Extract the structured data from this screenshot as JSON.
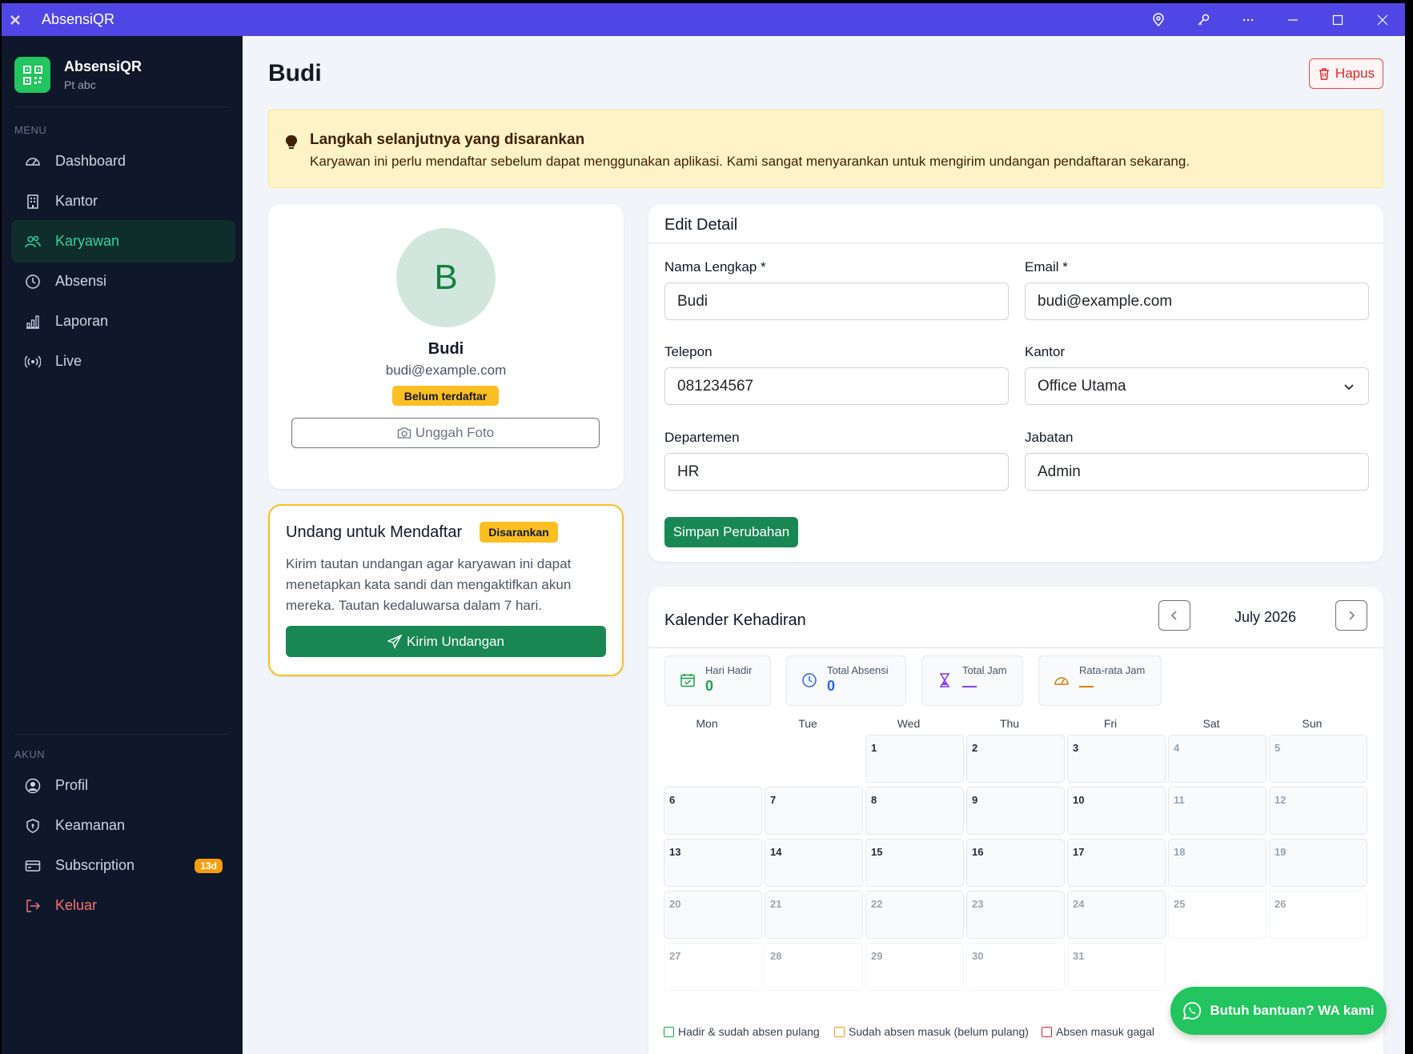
{
  "window": {
    "title": "AbsensiQR"
  },
  "brand": {
    "name": "AbsensiQR",
    "company": "Pt abc"
  },
  "sidebar": {
    "menu_label": "MENU",
    "items": [
      {
        "label": "Dashboard",
        "icon": "gauge-icon"
      },
      {
        "label": "Kantor",
        "icon": "building-icon"
      },
      {
        "label": "Karyawan",
        "icon": "users-icon",
        "active": true
      },
      {
        "label": "Absensi",
        "icon": "clock-icon"
      },
      {
        "label": "Laporan",
        "icon": "bar-chart-icon"
      },
      {
        "label": "Live",
        "icon": "broadcast-icon"
      }
    ],
    "account_label": "AKUN",
    "account_items": [
      {
        "label": "Profil",
        "icon": "user-circle-icon"
      },
      {
        "label": "Keamanan",
        "icon": "shield-icon"
      },
      {
        "label": "Subscription",
        "icon": "card-icon",
        "badge": "13d"
      },
      {
        "label": "Keluar",
        "icon": "logout-icon"
      }
    ]
  },
  "page": {
    "title": "Budi",
    "delete_label": "Hapus"
  },
  "alert": {
    "title": "Langkah selanjutnya yang disarankan",
    "text": "Karyawan ini perlu mendaftar sebelum dapat menggunakan aplikasi. Kami sangat menyarankan untuk mengirim undangan pendaftaran sekarang."
  },
  "profile": {
    "initial": "B",
    "name": "Budi",
    "email": "budi@example.com",
    "status": "Belum terdaftar",
    "upload_label": "Unggah Foto"
  },
  "invite": {
    "title": "Undang untuk Mendaftar",
    "badge": "Disarankan",
    "text": "Kirim tautan undangan agar karyawan ini dapat menetapkan kata sandi dan mengaktifkan akun mereka. Tautan kedaluwarsa dalam 7 hari.",
    "button": "Kirim Undangan"
  },
  "edit": {
    "title": "Edit Detail",
    "name_label": "Nama Lengkap *",
    "name_value": "Budi",
    "email_label": "Email *",
    "email_value": "budi@example.com",
    "phone_label": "Telepon",
    "phone_value": "081234567",
    "office_label": "Kantor",
    "office_value": "Office Utama",
    "dept_label": "Departemen",
    "dept_value": "HR",
    "position_label": "Jabatan",
    "position_value": "Admin",
    "save_label": "Simpan Perubahan"
  },
  "calendar": {
    "title": "Kalender Kehadiran",
    "month": "July 2026",
    "stats": [
      {
        "label": "Hari Hadir",
        "value": "0",
        "color": "#16a34a"
      },
      {
        "label": "Total Absensi",
        "value": "0",
        "color": "#2563eb"
      },
      {
        "label": "Total Jam",
        "value": "—",
        "color": "#7c3aed"
      },
      {
        "label": "Rata-rata Jam",
        "value": "—",
        "color": "#d97706"
      }
    ],
    "weekdays": [
      "Mon",
      "Tue",
      "Wed",
      "Thu",
      "Fri",
      "Sat",
      "Sun"
    ],
    "legend": [
      {
        "label": "Hadir & sudah absen pulang",
        "color": "#16a34a"
      },
      {
        "label": "Sudah absen masuk (belum pulang)",
        "color": "#f59e0b"
      },
      {
        "label": "Absen masuk gagal",
        "color": "#dc2626"
      }
    ]
  },
  "help": {
    "label": "Butuh bantuan? WA kami"
  },
  "colors": {
    "accent": "#4f46e5",
    "sidebar": "#0f172a",
    "primary": "#198754",
    "warning": "#fbbf24",
    "danger": "#dc2626"
  }
}
